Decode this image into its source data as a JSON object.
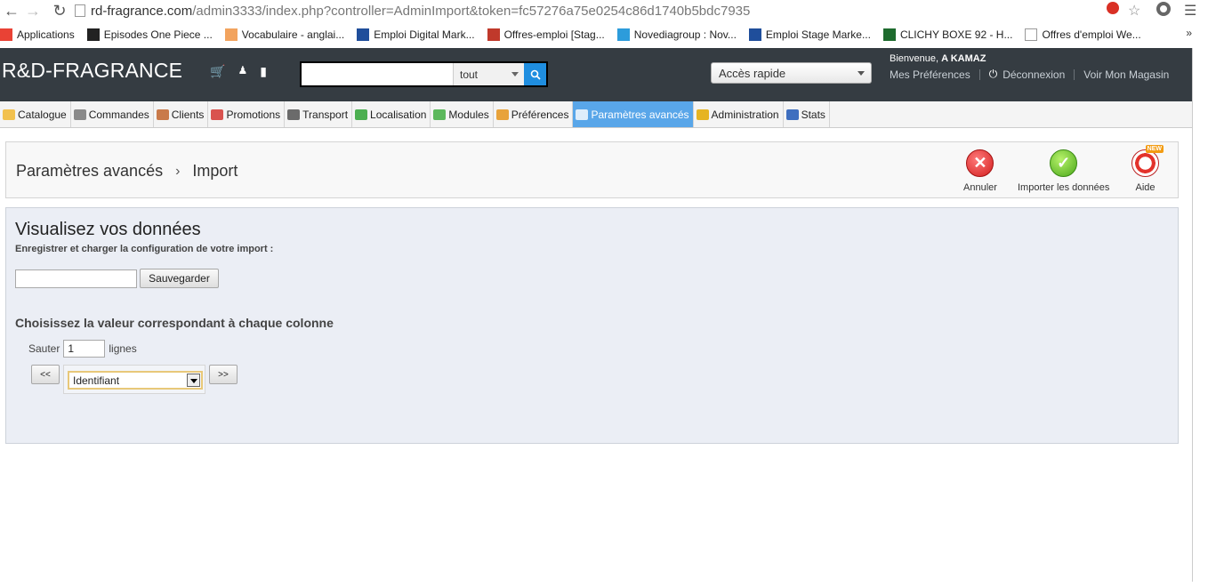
{
  "browser": {
    "url_domain": "rd-fragrance.com",
    "url_path": "/admin3333/index.php?controller=AdminImport&token=fc57276a75e0254c86d1740b5bdc7935",
    "bookmarks": [
      {
        "label": "Applications",
        "icon": "apps-grid-icon",
        "color": "#e94235"
      },
      {
        "label": "Episodes One Piece ...",
        "icon": "op-icon",
        "color": "#222222"
      },
      {
        "label": "Vocabulaire - anglai...",
        "icon": "vocab-icon",
        "color": "#f2a35e"
      },
      {
        "label": "Emploi Digital Mark...",
        "icon": "info-icon",
        "color": "#1f4e9b"
      },
      {
        "label": "Offres-emploi [Stag...",
        "icon": "cart-icon",
        "color": "#c0392b"
      },
      {
        "label": "Novediagroup : Nov...",
        "icon": "e-icon",
        "color": "#2d9cdb"
      },
      {
        "label": "Emploi Stage Marke...",
        "icon": "info-icon",
        "color": "#1f4e9b"
      },
      {
        "label": "CLICHY BOXE 92 - H...",
        "icon": "shield-icon",
        "color": "#1e6b2e"
      },
      {
        "label": "Offres d'emploi We...",
        "icon": "page-icon",
        "color": "#ffffff"
      }
    ],
    "bookmarks_more": "»"
  },
  "header": {
    "logo": "R&D-FRAGRANCE",
    "search_scope": "tout",
    "quick_access": "Accès rapide",
    "welcome_prefix": "Bienvenue, ",
    "welcome_user": "A KAMAZ",
    "links": {
      "preferences": "Mes Préférences",
      "logout": "Déconnexion",
      "shop": "Voir Mon Magasin"
    }
  },
  "menu": [
    {
      "label": "Catalogue",
      "icon": "folder-icon",
      "color": "#f2c14e",
      "active": false
    },
    {
      "label": "Commandes",
      "icon": "cart-icon",
      "color": "#8a8a8a",
      "active": false
    },
    {
      "label": "Clients",
      "icon": "user-icon",
      "color": "#c97a4a",
      "active": false
    },
    {
      "label": "Promotions",
      "icon": "promo-icon",
      "color": "#d9534f",
      "active": false
    },
    {
      "label": "Transport",
      "icon": "truck-icon",
      "color": "#6b6b6b",
      "active": false
    },
    {
      "label": "Localisation",
      "icon": "globe-icon",
      "color": "#4caf50",
      "active": false
    },
    {
      "label": "Modules",
      "icon": "puzzle-icon",
      "color": "#5cb85c",
      "active": false
    },
    {
      "label": "Préférences",
      "icon": "prefs-icon",
      "color": "#e8a33b",
      "active": false
    },
    {
      "label": "Paramètres avancés",
      "icon": "wrench-icon",
      "color": "#ffffff",
      "active": true
    },
    {
      "label": "Administration",
      "icon": "key-icon",
      "color": "#e6b422",
      "active": false
    },
    {
      "label": "Stats",
      "icon": "bar-chart-icon",
      "color": "#3f6fbf",
      "active": false
    }
  ],
  "page": {
    "breadcrumb": [
      "Paramètres avancés",
      "Import"
    ],
    "actions": {
      "cancel": "Annuler",
      "import": "Importer les données",
      "help": "Aide",
      "help_badge": "NEW"
    }
  },
  "content": {
    "title": "Visualisez vos données",
    "subtitle": "Enregistrer et charger la configuration de votre import :",
    "save_button": "Sauvegarder",
    "save_input_value": "",
    "section_title": "Choisissez la valeur correspondant à chaque colonne",
    "skip_label": "Sauter",
    "skip_value": "1",
    "skip_suffix": "lignes",
    "prev_button": "<<",
    "next_button": ">>",
    "column_value": "Identifiant"
  }
}
